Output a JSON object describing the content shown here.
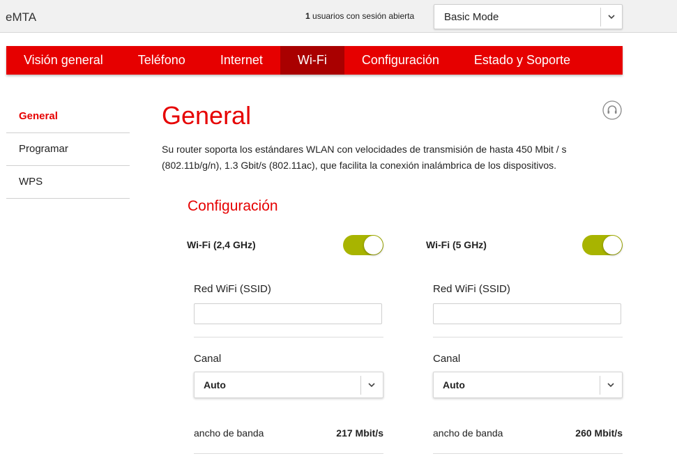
{
  "header": {
    "app_title": "eMTA",
    "sessions_count": "1",
    "sessions_text": "usuarios con sesión abierta",
    "mode_select_value": "Basic Mode"
  },
  "nav": {
    "tabs": [
      {
        "label": "Visión general",
        "active": false
      },
      {
        "label": "Teléfono",
        "active": false
      },
      {
        "label": "Internet",
        "active": false
      },
      {
        "label": "Wi-Fi",
        "active": true
      },
      {
        "label": "Configuración",
        "active": false
      },
      {
        "label": "Estado y Soporte",
        "active": false
      }
    ]
  },
  "sidebar": {
    "items": [
      {
        "label": "General",
        "active": true
      },
      {
        "label": "Programar",
        "active": false
      },
      {
        "label": "WPS",
        "active": false
      }
    ]
  },
  "main": {
    "title": "General",
    "intro": "Su router soporta los estándares WLAN con velocidades de transmisión de hasta 450 Mbit / s (802.11b/g/n), 1.3 Gbit/s (802.11ac), que facilita la conexión inalámbrica de los dispositivos.",
    "section_title": "Configuración",
    "help_icon": "headset-icon",
    "bands": [
      {
        "label": "Wi-Fi (2,4 GHz)",
        "enabled": true,
        "ssid_label": "Red WiFi (SSID)",
        "ssid_value": "",
        "channel_label": "Canal",
        "channel_value": "Auto",
        "bandwidth_label": "ancho de banda",
        "bandwidth_value": "217 Mbit/s"
      },
      {
        "label": "Wi-Fi (5 GHz)",
        "enabled": true,
        "ssid_label": "Red WiFi (SSID)",
        "ssid_value": "",
        "channel_label": "Canal",
        "channel_value": "Auto",
        "bandwidth_label": "ancho de banda",
        "bandwidth_value": "260 Mbit/s"
      }
    ]
  },
  "colors": {
    "brand_red": "#e60000",
    "active_tab": "#a90000",
    "toggle_on": "#a8b400"
  }
}
